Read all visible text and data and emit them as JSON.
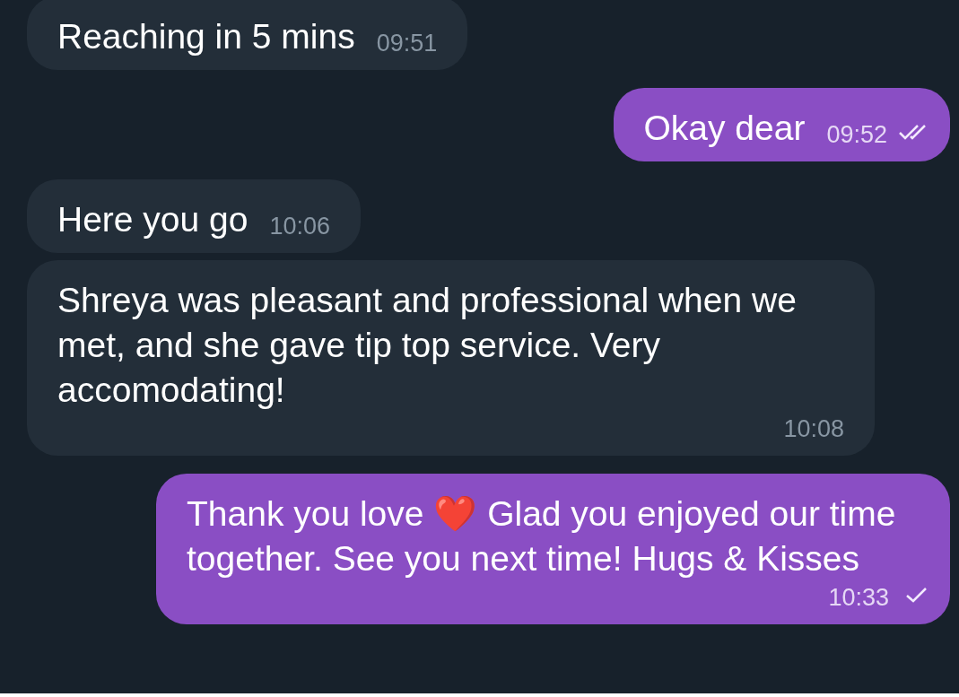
{
  "messages": [
    {
      "outgoing": false,
      "text": "Reaching in 5 mins",
      "time": "09:51"
    },
    {
      "outgoing": true,
      "text": "Okay dear",
      "time": "09:52",
      "read": true
    },
    {
      "outgoing": false,
      "text": "Here you go",
      "time": "10:06"
    },
    {
      "outgoing": false,
      "text": "Shreya was pleasant and professional when we met, and she gave tip top service. Very accomodating!",
      "time": "10:08"
    },
    {
      "outgoing": true,
      "text": "Thank you love ❤️ Glad you enjoyed our time together. See you next time! Hugs & Kisses",
      "time": "10:33",
      "read": false
    }
  ]
}
